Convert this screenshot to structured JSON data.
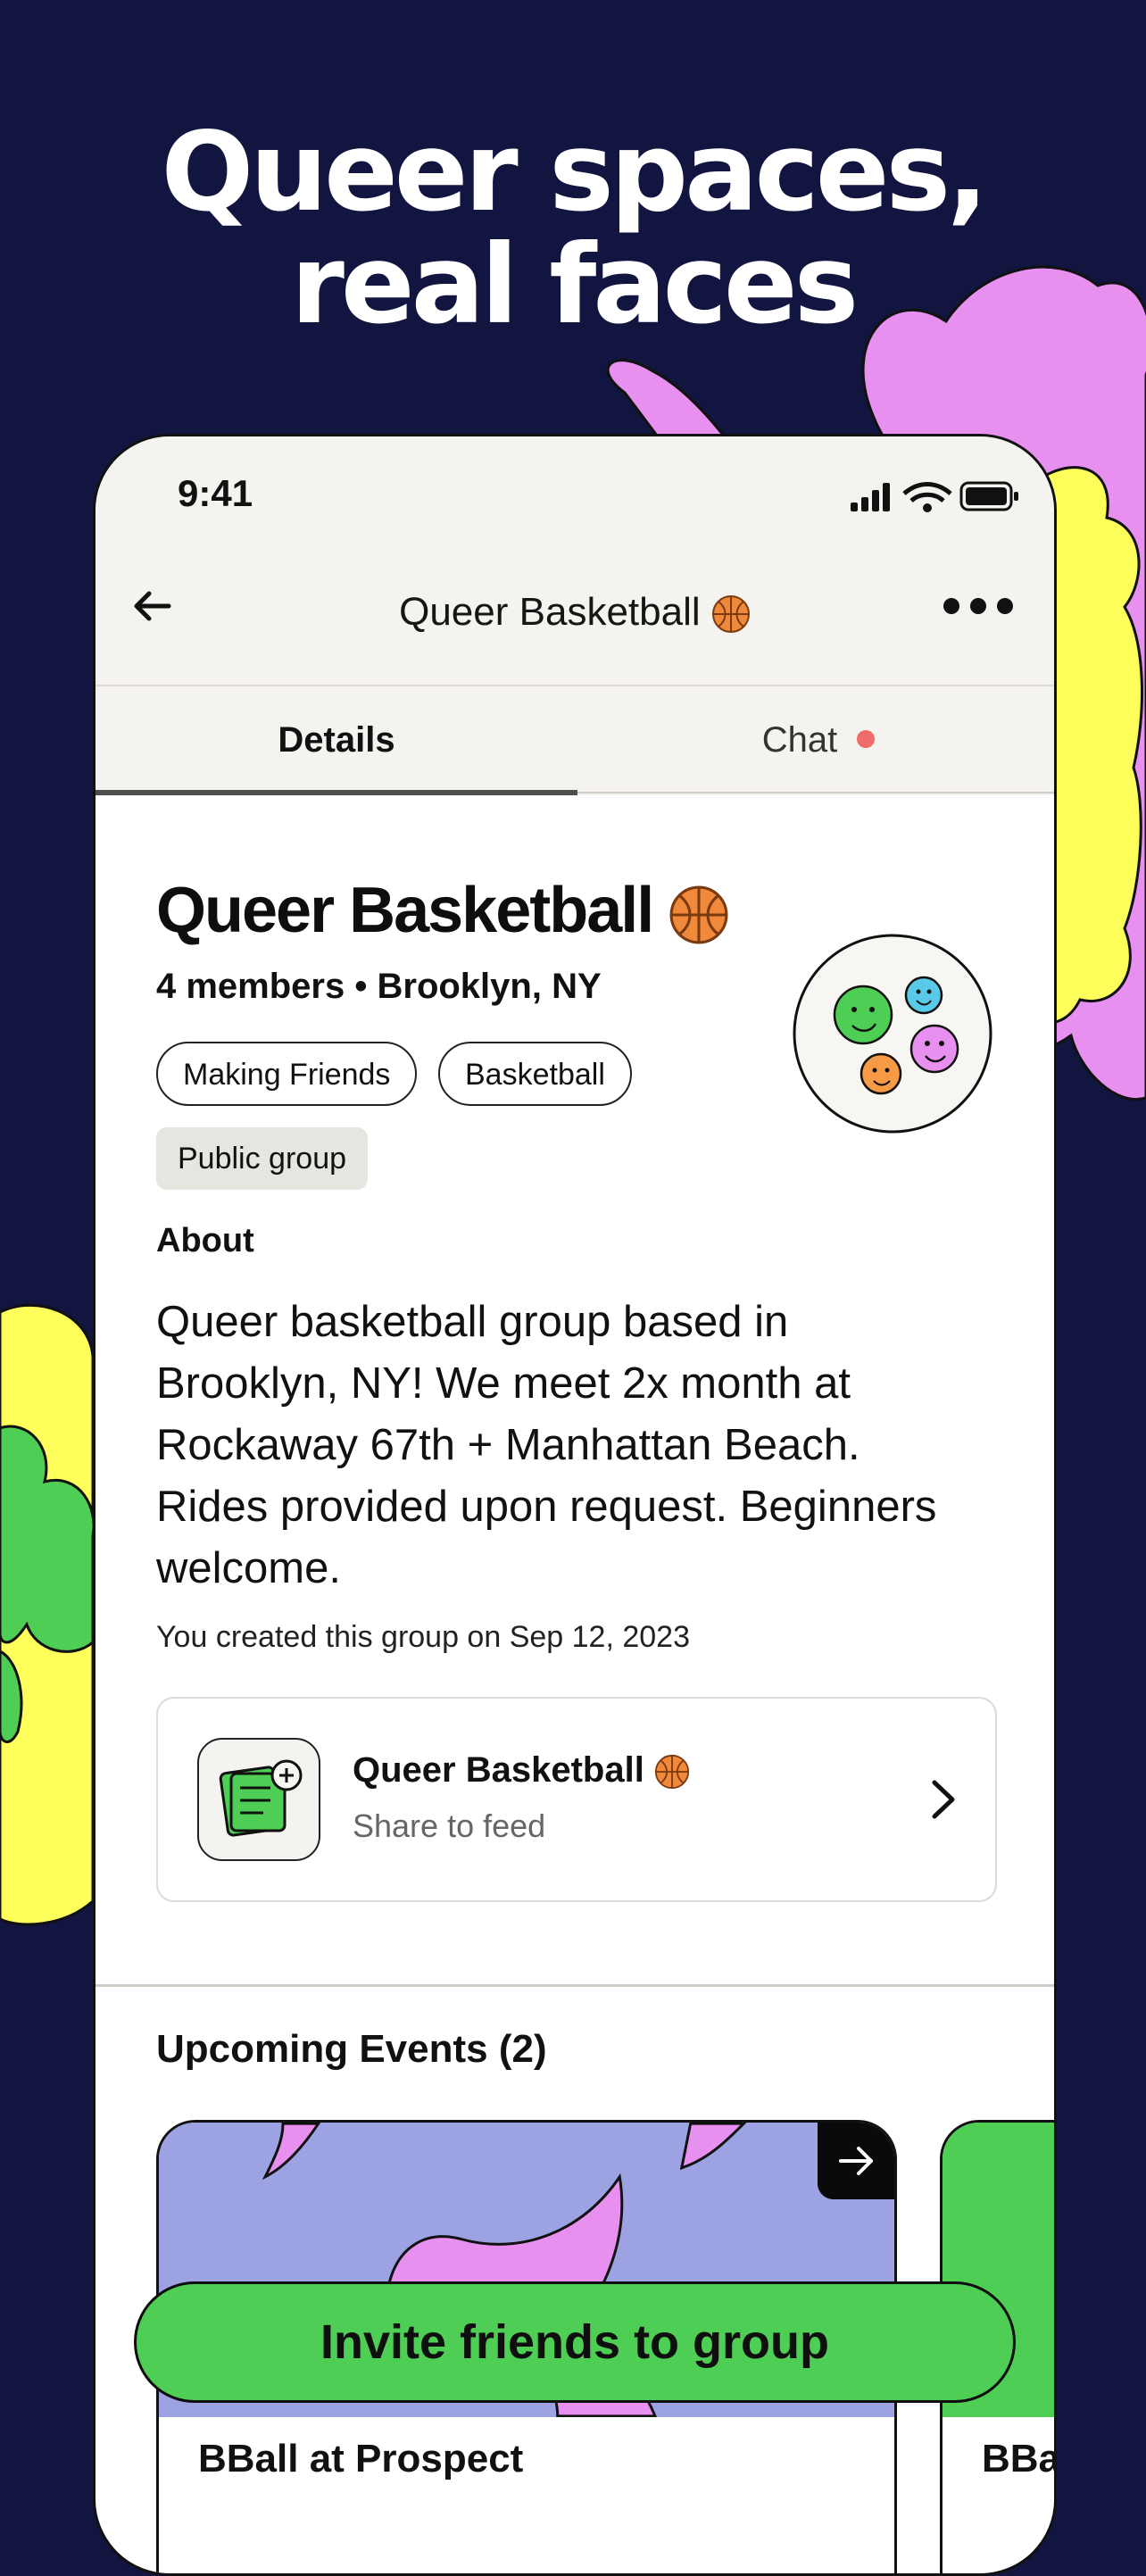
{
  "headline": {
    "line1": "Queer spaces,",
    "line2": "real faces"
  },
  "status_bar": {
    "time": "9:41"
  },
  "nav": {
    "title": "Queer Basketball",
    "back_icon": "arrow-left-icon",
    "more_icon": "more-horizontal-icon"
  },
  "tabs": [
    {
      "label": "Details",
      "active": true
    },
    {
      "label": "Chat",
      "active": false,
      "has_unread_dot": true
    }
  ],
  "group": {
    "name": "Queer Basketball",
    "members": "4 members",
    "location": "Brooklyn, NY",
    "chips": [
      "Making Friends",
      "Basketball"
    ],
    "visibility": "Public group",
    "about_heading": "About",
    "about_text": "Queer basketball group based in Brooklyn, NY! We meet 2x month at Rockaway 67th + Manhattan Beach. Rides provided upon request. Beginners welcome.",
    "created": "You created this group on Sep 12, 2023"
  },
  "share_card": {
    "title": "Queer Basketball",
    "subtitle": "Share to feed"
  },
  "events": {
    "heading": "Upcoming Events (2)",
    "items": [
      {
        "title": "BBall at Prospect"
      },
      {
        "title": "BBa"
      }
    ]
  },
  "cta": {
    "label": "Invite friends to group"
  },
  "colors": {
    "background": "#12153f",
    "accent_green": "#4fce55",
    "lilac": "#9da2e3",
    "pink": "#e890f0",
    "yellow": "#ffff5c",
    "unread_dot": "#f06b6b"
  }
}
